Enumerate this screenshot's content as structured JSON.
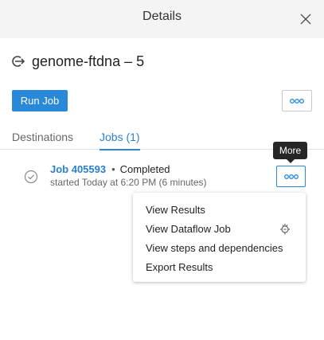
{
  "header": {
    "title": "Details"
  },
  "job": {
    "title": "genome-ftdna – 5"
  },
  "toolbar": {
    "run_job_label": "Run Job"
  },
  "tabs": [
    {
      "label": "Destinations",
      "active": false
    },
    {
      "label": "Jobs (1)",
      "active": true
    }
  ],
  "job_entry": {
    "link": "Job 405593",
    "separator": "•",
    "status": "Completed",
    "started": "started Today at 6:20 PM (6 minutes)"
  },
  "tooltip": {
    "text": "More"
  },
  "menu": {
    "items": [
      {
        "label": "View Results"
      },
      {
        "label": "View Dataflow Job"
      },
      {
        "label": "View steps and dependencies"
      },
      {
        "label": "Export Results"
      }
    ]
  },
  "colors": {
    "accent": "#2a88d8",
    "link": "#2a7fcf",
    "header_bg": "#f4f4f4",
    "tooltip_bg": "#262626"
  },
  "icons": [
    "close-icon",
    "flow-arrow-icon",
    "more-icon",
    "check-circle-icon",
    "dataflow-icon"
  ]
}
